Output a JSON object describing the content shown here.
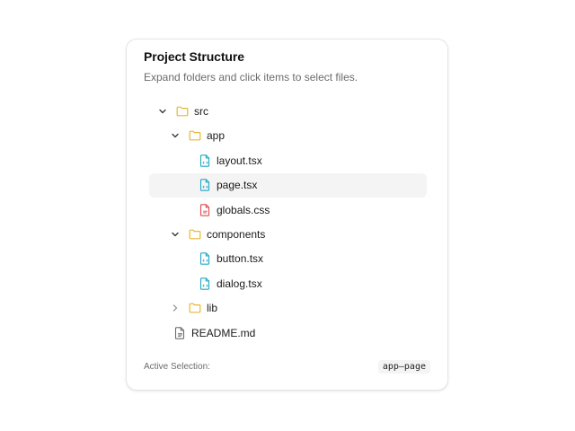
{
  "card": {
    "title": "Project Structure",
    "description": "Expand folders and click items to select files."
  },
  "tree": [
    {
      "label": "src",
      "type": "folder",
      "expanded": true,
      "depth": 0
    },
    {
      "label": "app",
      "type": "folder",
      "expanded": true,
      "depth": 1
    },
    {
      "label": "layout.tsx",
      "type": "tsx",
      "depth": 2
    },
    {
      "label": "page.tsx",
      "type": "tsx",
      "depth": 2,
      "selected": true
    },
    {
      "label": "globals.css",
      "type": "css",
      "depth": 2
    },
    {
      "label": "components",
      "type": "folder",
      "expanded": true,
      "depth": 1
    },
    {
      "label": "button.tsx",
      "type": "tsx",
      "depth": 2
    },
    {
      "label": "dialog.tsx",
      "type": "tsx",
      "depth": 2
    },
    {
      "label": "lib",
      "type": "folder",
      "expanded": false,
      "depth": 1
    },
    {
      "label": "README.md",
      "type": "text",
      "depth": 0
    }
  ],
  "footer": {
    "label": "Active Selection:",
    "value": "app–page"
  },
  "colors": {
    "folder": "#e7b732",
    "tsx": "#1ea7c5",
    "css": "#e0494a",
    "text": "#6b6b6b",
    "selected_bg": "#f4f4f5"
  },
  "icons": {
    "expanded": "chevron-down-icon",
    "collapsed": "chevron-right-icon",
    "folder": "folder-icon",
    "tsx": "tsx-file-icon",
    "css": "css-file-icon",
    "text": "text-file-icon"
  }
}
